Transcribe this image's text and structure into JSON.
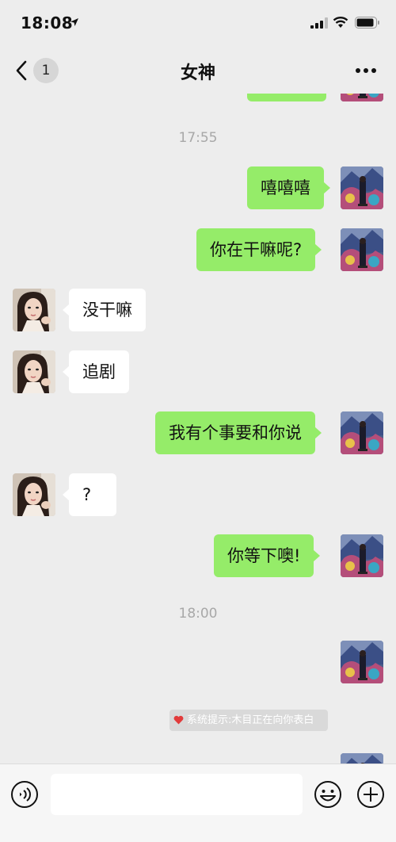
{
  "status_bar": {
    "time": "18:08",
    "icons": [
      "location-arrow-icon",
      "signal-icon",
      "wifi-icon",
      "battery-icon"
    ]
  },
  "nav": {
    "back_badge": "1",
    "title": "女神",
    "icons": [
      "back-chevron-icon",
      "more-icon"
    ]
  },
  "chat": {
    "timestamps": [
      "17:55",
      "18:00"
    ],
    "messages": [
      {
        "from": "me",
        "text": "嘻嘻嘻"
      },
      {
        "from": "me",
        "text": "你在干嘛呢?"
      },
      {
        "from": "her",
        "text": "没干嘛"
      },
      {
        "from": "her",
        "text": "追剧"
      },
      {
        "from": "me",
        "text": "我有个事要和你说"
      },
      {
        "from": "her",
        "text": "?"
      },
      {
        "from": "me",
        "text": "你等下噢!"
      }
    ],
    "system_notice": "系统提示:木目正在向你表白"
  },
  "input_bar": {
    "message_value": "",
    "icons": [
      "voice-icon",
      "emoji-icon",
      "plus-icon"
    ]
  },
  "colors": {
    "background": "#ededed",
    "outgoing_bubble": "#95ec69",
    "incoming_bubble": "#ffffff",
    "timestamp_text": "#a8a8a8",
    "notice_heart": "#e23b3b"
  }
}
